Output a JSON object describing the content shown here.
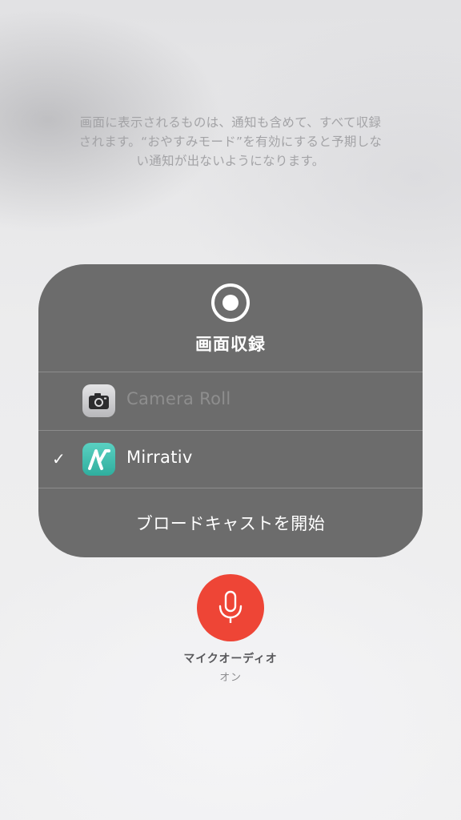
{
  "notice": {
    "line1": "画面に表示されるものは、通知も含めて、すべて収録",
    "line2": "されます。“おやすみモード”を有効にすると予期しな",
    "line3": "い通知が出ないようになります。"
  },
  "panel": {
    "title": "画面収録",
    "record_icon": "record-icon",
    "options": [
      {
        "label": "Camera Roll",
        "icon": "camera-icon",
        "selected": false,
        "enabled": false
      },
      {
        "label": "Mirrativ",
        "icon": "mirrativ-icon",
        "selected": true,
        "enabled": true
      }
    ],
    "check_mark": "✓",
    "start_label": "ブロードキャストを開始"
  },
  "mic": {
    "icon": "microphone-icon",
    "title": "マイクオーディオ",
    "state": "オン"
  },
  "colors": {
    "panel_bg": "#6c6c6c",
    "mic_button": "#ee4536",
    "mirrativ_app": "#3fbfae"
  }
}
